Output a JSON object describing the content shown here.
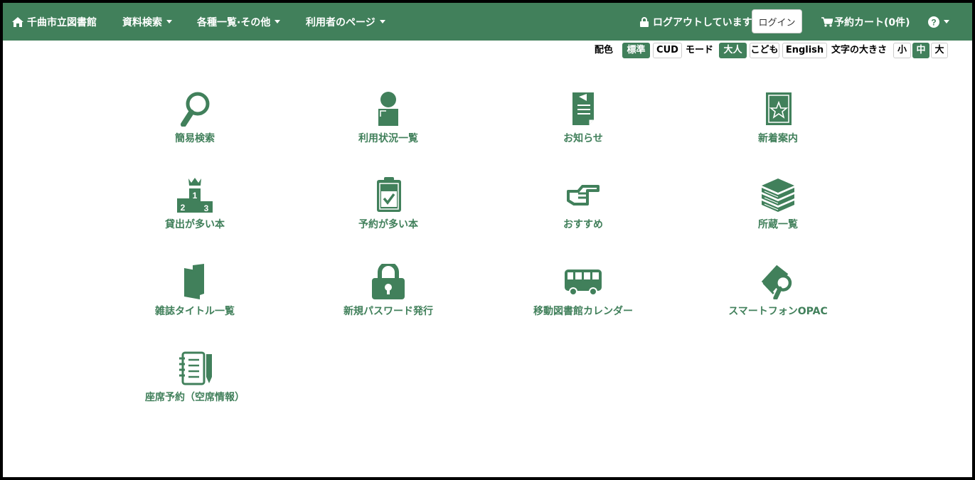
{
  "header": {
    "site_title": "千曲市立図書館",
    "menus": [
      "資料検索",
      "各種一覧·その他",
      "利用者のページ"
    ],
    "logout_status": "ログアウトしています",
    "login_label": "ログイン",
    "cart_label": "予約カート(0件)"
  },
  "settings": {
    "color_label": "配色",
    "color_options": [
      "標準",
      "CUD"
    ],
    "mode_label": "モード",
    "mode_options": [
      "大人",
      "こども",
      "English"
    ],
    "size_label": "文字の大きさ",
    "size_options": [
      "小",
      "中",
      "大"
    ],
    "active": {
      "color": "標準",
      "mode": "大人",
      "size": "中"
    }
  },
  "menu_tiles": [
    {
      "label": "簡易検索",
      "icon": "magnifier-icon"
    },
    {
      "label": "利用状況一覧",
      "icon": "person-icon"
    },
    {
      "label": "お知らせ",
      "icon": "notice-document-icon"
    },
    {
      "label": "新着案内",
      "icon": "book-star-icon"
    },
    {
      "label": "貸出が多い本",
      "icon": "ranking-podium-icon"
    },
    {
      "label": "予約が多い本",
      "icon": "clipboard-check-icon"
    },
    {
      "label": "おすすめ",
      "icon": "pointing-hand-icon"
    },
    {
      "label": "所蔵一覧",
      "icon": "book-stack-icon"
    },
    {
      "label": "雑誌タイトル一覧",
      "icon": "magazine-icon"
    },
    {
      "label": "新規パスワード発行",
      "icon": "padlock-icon"
    },
    {
      "label": "移動図書館カレンダー",
      "icon": "bus-icon"
    },
    {
      "label": "スマートフォンOPAC",
      "icon": "book-search-icon"
    },
    {
      "label": "座席予約（空席情報）",
      "icon": "notebook-pencil-icon"
    }
  ],
  "colors": {
    "accent": "#41805b",
    "background": "#ffffff"
  }
}
